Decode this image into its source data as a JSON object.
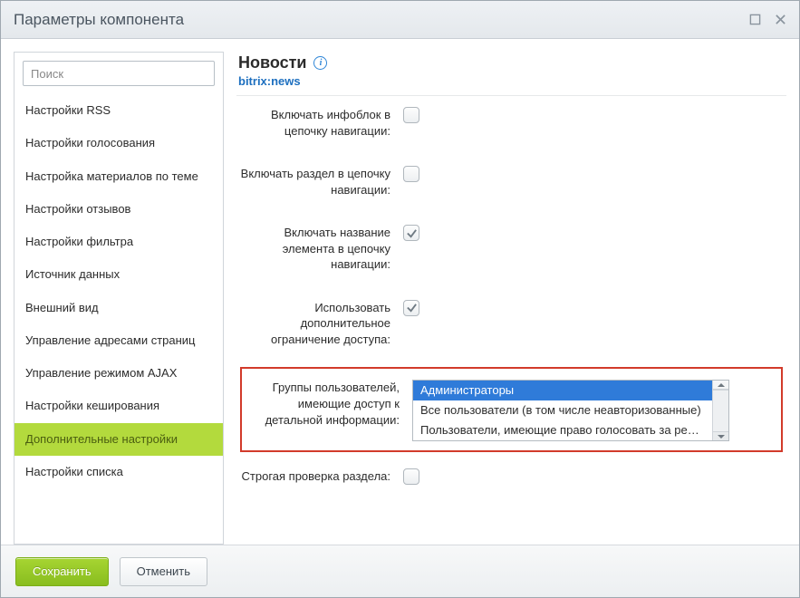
{
  "window": {
    "title": "Параметры компонента"
  },
  "sidebar": {
    "search_placeholder": "Поиск",
    "items": [
      {
        "label": "Настройки RSS"
      },
      {
        "label": "Настройки голосования"
      },
      {
        "label": "Настройка материалов по теме"
      },
      {
        "label": "Настройки отзывов"
      },
      {
        "label": "Настройки фильтра"
      },
      {
        "label": "Источник данных"
      },
      {
        "label": "Внешний вид"
      },
      {
        "label": "Управление адресами страниц"
      },
      {
        "label": "Управление режимом AJAX"
      },
      {
        "label": "Настройки кеширования"
      },
      {
        "label": "Дополнительные настройки",
        "active": true
      },
      {
        "label": "Настройки списка"
      }
    ]
  },
  "main": {
    "heading": "Новости",
    "component_code": "bitrix:news",
    "params": {
      "add_iblock_to_chain": {
        "label": "Включать инфоблок в цепочку навигации:",
        "checked": false
      },
      "add_section_to_chain": {
        "label": "Включать раздел в цепочку навигации:",
        "checked": false
      },
      "add_element_to_chain": {
        "label": "Включать название элемента в цепочку навигации:",
        "checked": true
      },
      "use_extra_permissions": {
        "label": "Использовать дополнительное ограничение доступа:",
        "checked": true
      },
      "detail_access_groups": {
        "label": "Группы пользователей, имеющие доступ к детальной информации:",
        "options": [
          {
            "text": "Администраторы",
            "selected": true
          },
          {
            "text": "Все пользователи (в том числе неавторизованные)",
            "selected": false
          },
          {
            "text": "Пользователи, имеющие право голосовать за рейтинг",
            "selected": false
          }
        ]
      },
      "strict_section_check": {
        "label": "Строгая проверка раздела:",
        "checked": false
      }
    }
  },
  "footer": {
    "save": "Сохранить",
    "cancel": "Отменить"
  }
}
